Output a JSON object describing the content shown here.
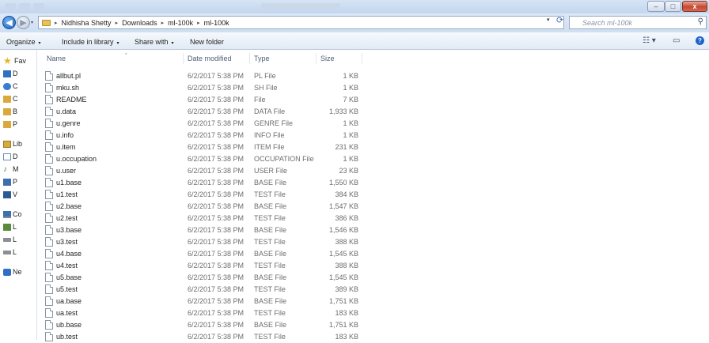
{
  "window": {
    "minimize_glyph": "–",
    "maximize_glyph": "□",
    "close_glyph": "x"
  },
  "address": {
    "separator": "▸",
    "breadcrumb": [
      "Nidhisha Shetty",
      "Downloads",
      "ml-100k",
      "ml-100k"
    ],
    "dropdown_glyph": "▾",
    "refresh_glyph": "⟳"
  },
  "search": {
    "placeholder": "Search ml-100k",
    "icon": "search-icon",
    "icon_glyph": "⚲"
  },
  "toolbar": {
    "organize": "Organize",
    "include": "Include in library",
    "share": "Share with",
    "new_folder": "New folder",
    "caret": "▾",
    "views_glyph": "☷ ▾",
    "pane_glyph": "▭",
    "help_glyph": "?"
  },
  "nav": [
    {
      "label": "Fav",
      "icon": "star-icon",
      "color": "#e8b42a"
    },
    {
      "label": "D",
      "icon": "desktop-icon",
      "color": "#2f6fc4"
    },
    {
      "label": "C",
      "icon": "cloud-icon",
      "color": "#3a7bd5"
    },
    {
      "label": "C",
      "icon": "folder-icon",
      "color": "#d9a93c"
    },
    {
      "label": "B",
      "icon": "folder-icon",
      "color": "#d9a93c"
    },
    {
      "label": "P",
      "icon": "folder-icon",
      "color": "#d9a93c"
    },
    {
      "label": "Lib",
      "icon": "library-icon",
      "color": "#d9a93c"
    },
    {
      "label": "D",
      "icon": "document-icon",
      "color": "#6b8db8"
    },
    {
      "label": "M",
      "icon": "music-icon",
      "color": "#2d8a3e"
    },
    {
      "label": "P",
      "icon": "picture-icon",
      "color": "#3b6fae"
    },
    {
      "label": "V",
      "icon": "video-icon",
      "color": "#2b5a94"
    },
    {
      "label": "Co",
      "icon": "computer-icon",
      "color": "#3b6fae"
    },
    {
      "label": "L",
      "icon": "drive-icon",
      "color": "#5a8a3a"
    },
    {
      "label": "L",
      "icon": "drive-icon",
      "color": "#8a8f96"
    },
    {
      "label": "L",
      "icon": "drive-icon",
      "color": "#8a8f96"
    },
    {
      "label": "Ne",
      "icon": "network-icon",
      "color": "#2f6fc4"
    }
  ],
  "columns": {
    "name": "Name",
    "date": "Date modified",
    "type": "Type",
    "size": "Size",
    "sort_glyph": "^"
  },
  "files": [
    {
      "name": "allbut.pl",
      "date": "6/2/2017 5:38 PM",
      "type": "PL File",
      "size": "1 KB"
    },
    {
      "name": "mku.sh",
      "date": "6/2/2017 5:38 PM",
      "type": "SH File",
      "size": "1 KB"
    },
    {
      "name": "README",
      "date": "6/2/2017 5:38 PM",
      "type": "File",
      "size": "7 KB"
    },
    {
      "name": "u.data",
      "date": "6/2/2017 5:38 PM",
      "type": "DATA File",
      "size": "1,933 KB"
    },
    {
      "name": "u.genre",
      "date": "6/2/2017 5:38 PM",
      "type": "GENRE File",
      "size": "1 KB"
    },
    {
      "name": "u.info",
      "date": "6/2/2017 5:38 PM",
      "type": "INFO File",
      "size": "1 KB"
    },
    {
      "name": "u.item",
      "date": "6/2/2017 5:38 PM",
      "type": "ITEM File",
      "size": "231 KB"
    },
    {
      "name": "u.occupation",
      "date": "6/2/2017 5:38 PM",
      "type": "OCCUPATION File",
      "size": "1 KB"
    },
    {
      "name": "u.user",
      "date": "6/2/2017 5:38 PM",
      "type": "USER File",
      "size": "23 KB"
    },
    {
      "name": "u1.base",
      "date": "6/2/2017 5:38 PM",
      "type": "BASE File",
      "size": "1,550 KB"
    },
    {
      "name": "u1.test",
      "date": "6/2/2017 5:38 PM",
      "type": "TEST File",
      "size": "384 KB"
    },
    {
      "name": "u2.base",
      "date": "6/2/2017 5:38 PM",
      "type": "BASE File",
      "size": "1,547 KB"
    },
    {
      "name": "u2.test",
      "date": "6/2/2017 5:38 PM",
      "type": "TEST File",
      "size": "386 KB"
    },
    {
      "name": "u3.base",
      "date": "6/2/2017 5:38 PM",
      "type": "BASE File",
      "size": "1,546 KB"
    },
    {
      "name": "u3.test",
      "date": "6/2/2017 5:38 PM",
      "type": "TEST File",
      "size": "388 KB"
    },
    {
      "name": "u4.base",
      "date": "6/2/2017 5:38 PM",
      "type": "BASE File",
      "size": "1,545 KB"
    },
    {
      "name": "u4.test",
      "date": "6/2/2017 5:38 PM",
      "type": "TEST File",
      "size": "388 KB"
    },
    {
      "name": "u5.base",
      "date": "6/2/2017 5:38 PM",
      "type": "BASE File",
      "size": "1,545 KB"
    },
    {
      "name": "u5.test",
      "date": "6/2/2017 5:38 PM",
      "type": "TEST File",
      "size": "389 KB"
    },
    {
      "name": "ua.base",
      "date": "6/2/2017 5:38 PM",
      "type": "BASE File",
      "size": "1,751 KB"
    },
    {
      "name": "ua.test",
      "date": "6/2/2017 5:38 PM",
      "type": "TEST File",
      "size": "183 KB"
    },
    {
      "name": "ub.base",
      "date": "6/2/2017 5:38 PM",
      "type": "BASE File",
      "size": "1,751 KB"
    },
    {
      "name": "ub.test",
      "date": "6/2/2017 5:38 PM",
      "type": "TEST File",
      "size": "183 KB"
    }
  ]
}
